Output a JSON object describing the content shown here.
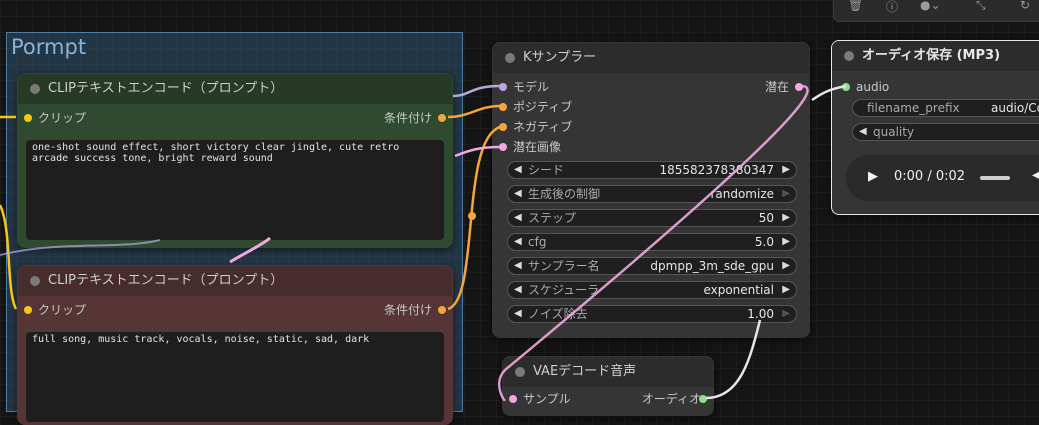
{
  "group": {
    "title": "Pormpt"
  },
  "clip_pos": {
    "title": "CLIPテキストエンコード（プロンプト）",
    "input_label": "クリップ",
    "output_label": "条件付け",
    "text": "one-shot sound effect, short victory clear jingle, cute retro arcade success tone, bright reward sound"
  },
  "clip_neg": {
    "title": "CLIPテキストエンコード（プロンプト）",
    "input_label": "クリップ",
    "output_label": "条件付け",
    "text": "full song, music track, vocals, noise, static, sad, dark"
  },
  "ksampler": {
    "title": "Kサンプラー",
    "inputs": [
      "モデル",
      "ポジティブ",
      "ネガティブ",
      "潜在画像"
    ],
    "output_label": "潜在",
    "widgets": [
      {
        "label": "シード",
        "value": "185582378380347"
      },
      {
        "label": "生成後の制御",
        "value": "randomize"
      },
      {
        "label": "ステップ",
        "value": "50"
      },
      {
        "label": "cfg",
        "value": "5.0"
      },
      {
        "label": "サンプラー名",
        "value": "dpmpp_3m_sde_gpu"
      },
      {
        "label": "スケジューラ",
        "value": "exponential"
      },
      {
        "label": "ノイズ除去",
        "value": "1.00"
      }
    ]
  },
  "vae": {
    "title": "VAEデコード音声",
    "input_label": "サンプル",
    "output_label": "オーディオ"
  },
  "audio_save": {
    "title": "オーディオ保存 (MP3)",
    "input_label": "audio",
    "filename_label": "filename_prefix",
    "filename_value": "audio/Co",
    "quality_label": "quality",
    "time": "0:00 / 0:02"
  },
  "colors": {
    "clip_wire": "#f5c518",
    "cond_wire": "#f5a53a",
    "model_wire": "#b7a6e0",
    "latent_wire": "#f2a8e0",
    "audio_wire": "#e6e6e6"
  }
}
